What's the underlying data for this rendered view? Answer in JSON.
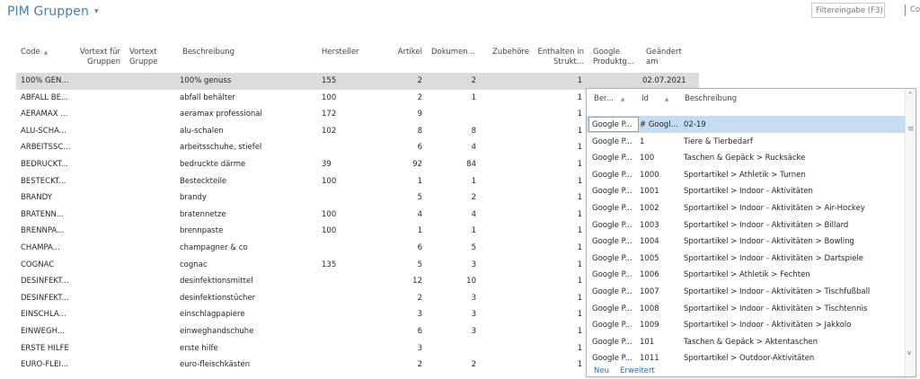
{
  "page": {
    "title": "PIM Gruppen",
    "caret": "▾",
    "filter_placeholder": "Filtereingabe (F3)",
    "filter_extra": "Co"
  },
  "columns": {
    "code": "Code",
    "vortext_gruppen": "Vortext für Gruppen",
    "vortext_gruppe": "Vortext Gruppe",
    "beschreibung": "Beschreibung",
    "hersteller": "Hersteller",
    "artikel": "Artikel",
    "dokumente": "Dokumen...",
    "zubehoere": "Zubehöre",
    "enthalten": "Enthalten in Strukt...",
    "google": "Google Produktg...",
    "geaendert": "Geändert am"
  },
  "rows": [
    {
      "code": "100% GEN...",
      "beschreibung": "100% genuss",
      "hersteller": "155",
      "artikel": "2",
      "dokumente": "2",
      "enthalten": "1",
      "geaendert": "02.07.2021"
    },
    {
      "code": "ABFALL BE...",
      "beschreibung": "abfall behälter",
      "hersteller": "100",
      "artikel": "2",
      "dokumente": "1",
      "enthalten": "1",
      "geaendert": ""
    },
    {
      "code": "AERAMAX ...",
      "beschreibung": "aeramax professional",
      "hersteller": "172",
      "artikel": "9",
      "dokumente": "",
      "enthalten": "1",
      "geaendert": ""
    },
    {
      "code": "ALU-SCHA...",
      "beschreibung": "alu-schalen",
      "hersteller": "102",
      "artikel": "8",
      "dokumente": "8",
      "enthalten": "1",
      "geaendert": ""
    },
    {
      "code": "ARBEITSSC...",
      "beschreibung": "arbeitsschuhe, stiefel",
      "hersteller": "",
      "artikel": "6",
      "dokumente": "4",
      "enthalten": "1",
      "geaendert": ""
    },
    {
      "code": "BEDRUCKT...",
      "beschreibung": "bedruckte därme",
      "hersteller": "39",
      "artikel": "92",
      "dokumente": "84",
      "enthalten": "1",
      "geaendert": ""
    },
    {
      "code": "BESTECKT...",
      "beschreibung": "Besteckteile",
      "hersteller": "100",
      "artikel": "1",
      "dokumente": "1",
      "enthalten": "1",
      "geaendert": ""
    },
    {
      "code": "BRANDY",
      "beschreibung": "brandy",
      "hersteller": "",
      "artikel": "5",
      "dokumente": "2",
      "enthalten": "1",
      "geaendert": ""
    },
    {
      "code": "BRATENN...",
      "beschreibung": "bratennetze",
      "hersteller": "100",
      "artikel": "4",
      "dokumente": "4",
      "enthalten": "1",
      "geaendert": ""
    },
    {
      "code": "BRENNPA...",
      "beschreibung": "brennpaste",
      "hersteller": "100",
      "artikel": "1",
      "dokumente": "1",
      "enthalten": "1",
      "geaendert": ""
    },
    {
      "code": "CHAMPA...",
      "beschreibung": "champagner & co",
      "hersteller": "",
      "artikel": "6",
      "dokumente": "5",
      "enthalten": "1",
      "geaendert": ""
    },
    {
      "code": "COGNAC",
      "beschreibung": "cognac",
      "hersteller": "135",
      "artikel": "5",
      "dokumente": "3",
      "enthalten": "1",
      "geaendert": ""
    },
    {
      "code": "DESINFEKT...",
      "beschreibung": "desinfektionsmittel",
      "hersteller": "",
      "artikel": "12",
      "dokumente": "10",
      "enthalten": "1",
      "geaendert": ""
    },
    {
      "code": "DESINFEKT...",
      "beschreibung": "desinfektionstücher",
      "hersteller": "",
      "artikel": "2",
      "dokumente": "3",
      "enthalten": "1",
      "geaendert": ""
    },
    {
      "code": "EINSCHLA...",
      "beschreibung": "einschlagpapiere",
      "hersteller": "",
      "artikel": "3",
      "dokumente": "3",
      "enthalten": "1",
      "geaendert": ""
    },
    {
      "code": "EINWEGH...",
      "beschreibung": "einweghandschuhe",
      "hersteller": "",
      "artikel": "6",
      "dokumente": "3",
      "enthalten": "1",
      "geaendert": ""
    },
    {
      "code": "ERSTE HILFE",
      "beschreibung": "erste hilfe",
      "hersteller": "",
      "artikel": "3",
      "dokumente": "",
      "enthalten": "1",
      "geaendert": ""
    },
    {
      "code": "EURO-FLEI...",
      "beschreibung": "euro-fleischkästen",
      "hersteller": "",
      "artikel": "2",
      "dokumente": "2",
      "enthalten": "1",
      "geaendert": ""
    }
  ],
  "popup": {
    "col_ber": "Ber...",
    "col_id": "Id",
    "col_beschreibung": "Beschreibung",
    "rows": [
      {
        "ber": "Google P...",
        "id": "# Googl...",
        "beschreibung": "02-19"
      },
      {
        "ber": "Google P...",
        "id": "1",
        "beschreibung": "Tiere & Tierbedarf"
      },
      {
        "ber": "Google P...",
        "id": "100",
        "beschreibung": "Taschen & Gepäck > Rucksäcke"
      },
      {
        "ber": "Google P...",
        "id": "1000",
        "beschreibung": "Sportartikel > Athletik > Turnen"
      },
      {
        "ber": "Google P...",
        "id": "1001",
        "beschreibung": "Sportartikel > Indoor - Aktivitäten"
      },
      {
        "ber": "Google P...",
        "id": "1002",
        "beschreibung": "Sportartikel > Indoor - Aktivitäten > Air-Hockey"
      },
      {
        "ber": "Google P...",
        "id": "1003",
        "beschreibung": "Sportartikel > Indoor - Aktivitäten > Billard"
      },
      {
        "ber": "Google P...",
        "id": "1004",
        "beschreibung": "Sportartikel > Indoor - Aktivitäten > Bowling"
      },
      {
        "ber": "Google P...",
        "id": "1005",
        "beschreibung": "Sportartikel > Indoor - Aktivitäten > Dartspiele"
      },
      {
        "ber": "Google P...",
        "id": "1006",
        "beschreibung": "Sportartikel > Athletik > Fechten"
      },
      {
        "ber": "Google P...",
        "id": "1007",
        "beschreibung": "Sportartikel > Indoor - Aktivitäten > Tischfußball"
      },
      {
        "ber": "Google P...",
        "id": "1008",
        "beschreibung": "Sportartikel > Indoor - Aktivitäten > Tischtennis"
      },
      {
        "ber": "Google P...",
        "id": "1009",
        "beschreibung": "Sportartikel > Indoor - Aktivitäten > Jakkolo"
      },
      {
        "ber": "Google P...",
        "id": "101",
        "beschreibung": "Taschen & Gepäck > Aktentaschen"
      },
      {
        "ber": "Google P...",
        "id": "1011",
        "beschreibung": "Sportartikel > Outdoor-Aktivitäten"
      }
    ],
    "link_neu": "Neu",
    "link_erweitert": "Erweitert",
    "scroll_up": "^",
    "scroll_down": "v",
    "scroll_grip": "≡"
  },
  "sort_arrow": "▲"
}
